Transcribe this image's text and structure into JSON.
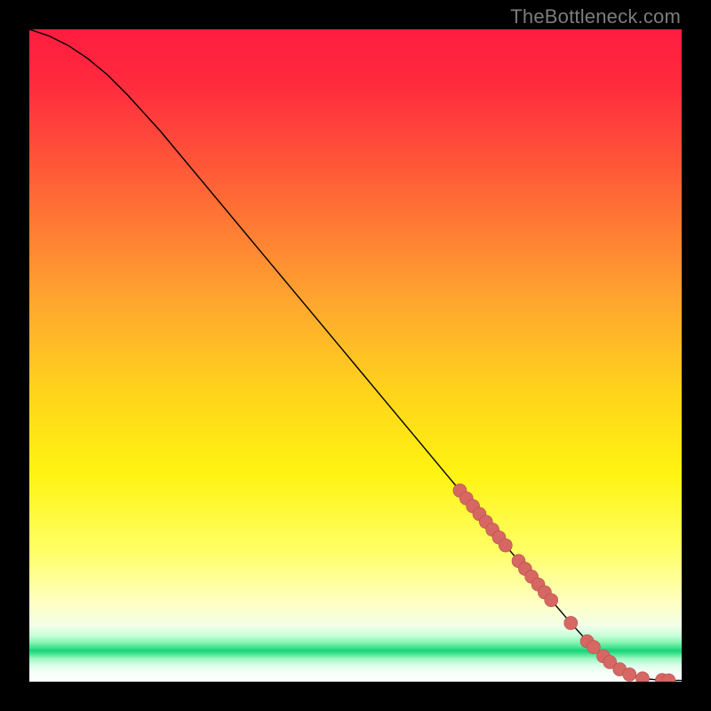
{
  "watermark": "TheBottleneck.com",
  "chart_data": {
    "type": "line",
    "title": "",
    "xlabel": "",
    "ylabel": "",
    "xlim": [
      0,
      100
    ],
    "ylim": [
      0,
      100
    ],
    "grid": false,
    "legend": false,
    "series": [
      {
        "name": "bottleneck-curve",
        "x": [
          0,
          3,
          6,
          9,
          12,
          15,
          20,
          25,
          30,
          35,
          40,
          45,
          50,
          55,
          60,
          65,
          70,
          75,
          80,
          83,
          85,
          87,
          89,
          90,
          92,
          94,
          96,
          98,
          100
        ],
        "y": [
          100,
          99,
          97.5,
          95.5,
          93,
          90,
          84.5,
          78.5,
          72.5,
          66.5,
          60.5,
          54.5,
          48.5,
          42.5,
          36.5,
          30.5,
          24.5,
          18.5,
          12.5,
          9,
          6.8,
          4.8,
          3.0,
          2.1,
          1.1,
          0.5,
          0.3,
          0.2,
          0.2
        ]
      }
    ],
    "markers": {
      "name": "highlighted-points",
      "x": [
        66,
        67,
        68,
        69,
        70,
        71,
        72,
        73,
        75,
        76,
        77,
        78,
        79,
        80,
        83,
        85.5,
        86.5,
        88,
        89,
        90.5,
        92,
        94,
        97,
        98
      ],
      "y": [
        29.3,
        28.1,
        26.9,
        25.7,
        24.5,
        23.3,
        22.1,
        20.9,
        18.5,
        17.3,
        16.1,
        14.9,
        13.7,
        12.5,
        9.0,
        6.2,
        5.3,
        3.9,
        3.0,
        1.9,
        1.1,
        0.5,
        0.25,
        0.2
      ]
    },
    "background_gradient": {
      "description": "vertical heat gradient red->orange->yellow->pale-yellow->pale-green->white with thin green band near bottom",
      "stops": [
        {
          "t": 0.0,
          "color": "#ff1c3f"
        },
        {
          "t": 0.08,
          "color": "#ff2a3e"
        },
        {
          "t": 0.18,
          "color": "#ff4d3a"
        },
        {
          "t": 0.3,
          "color": "#ff7a34"
        },
        {
          "t": 0.42,
          "color": "#ffa72f"
        },
        {
          "t": 0.55,
          "color": "#ffd21c"
        },
        {
          "t": 0.68,
          "color": "#fff311"
        },
        {
          "t": 0.8,
          "color": "#ffff66"
        },
        {
          "t": 0.88,
          "color": "#ffffc4"
        },
        {
          "t": 0.915,
          "color": "#f2ffe8"
        },
        {
          "t": 0.93,
          "color": "#c8ffda"
        },
        {
          "t": 0.94,
          "color": "#8cf5b5"
        },
        {
          "t": 0.948,
          "color": "#46e38f"
        },
        {
          "t": 0.953,
          "color": "#17d47b"
        },
        {
          "t": 0.958,
          "color": "#46e38f"
        },
        {
          "t": 0.965,
          "color": "#9af6c0"
        },
        {
          "t": 0.975,
          "color": "#d8ffe8"
        },
        {
          "t": 0.985,
          "color": "#f4fff6"
        },
        {
          "t": 1.0,
          "color": "#ffffff"
        }
      ]
    }
  }
}
